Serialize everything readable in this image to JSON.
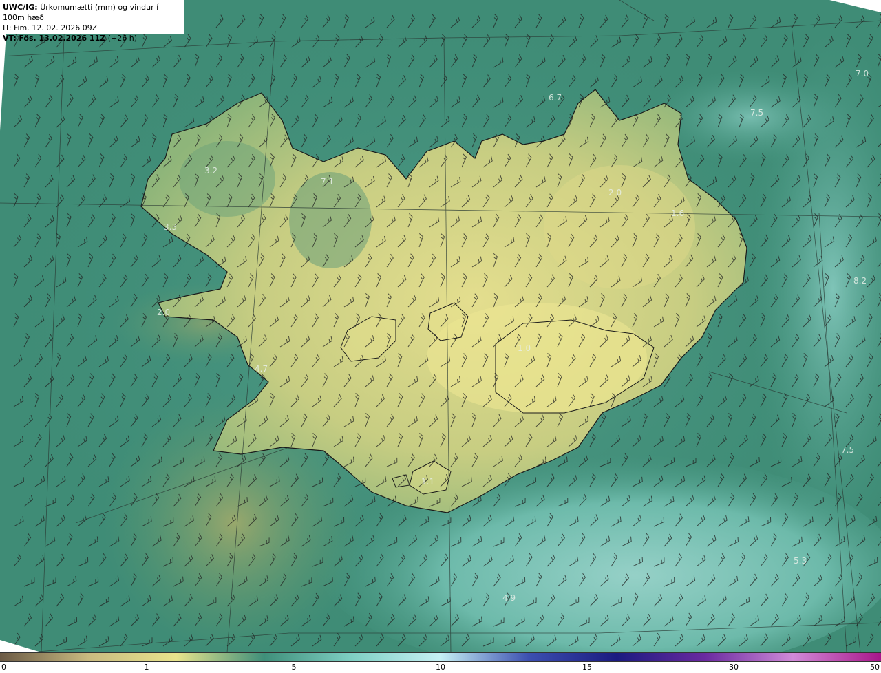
{
  "header": {
    "model": "UWC/IG:",
    "title": "Úrkomumætti (mm) og vindur í 100m hæð",
    "init_time": "IT: Fim. 12. 02. 2026 09Z",
    "valid_prefix": "VT:",
    "valid_time": "Fös. 13.02.2026 11Z",
    "lead": "(+26 h)"
  },
  "map_labels": [
    {
      "id": "v1",
      "text": "6.7"
    },
    {
      "id": "v2",
      "text": "7.0"
    },
    {
      "id": "v3",
      "text": "7.5"
    },
    {
      "id": "v4",
      "text": "3.2"
    },
    {
      "id": "v5",
      "text": "7.1"
    },
    {
      "id": "v6",
      "text": "3.3"
    },
    {
      "id": "v7",
      "text": "2.0"
    },
    {
      "id": "v8",
      "text": "1.6"
    },
    {
      "id": "v9",
      "text": "2.0"
    },
    {
      "id": "v10",
      "text": "8.2"
    },
    {
      "id": "v11",
      "text": "1.0"
    },
    {
      "id": "v12",
      "text": "4.7"
    },
    {
      "id": "v13",
      "text": "7.5"
    },
    {
      "id": "v14",
      "text": "1.1"
    },
    {
      "id": "v15",
      "text": "5.3"
    },
    {
      "id": "v16",
      "text": "4.9"
    }
  ],
  "colorbar": {
    "ticks": [
      "0",
      "1",
      "5",
      "10",
      "15",
      "30",
      "50"
    ],
    "colors": [
      "#6b5a45",
      "#c9ba80",
      "#e8e48c",
      "#3f8f7a",
      "#7fd0c4",
      "#c6f0f4",
      "#3c4fb0",
      "#1b1b80",
      "#6a2aa0",
      "#d08ad8",
      "#a8168a"
    ]
  },
  "colors": {
    "sea": "#3e8e78",
    "land_low": "#cfd58a",
    "coastline": "#1a1a1a",
    "barb": "#222222"
  }
}
